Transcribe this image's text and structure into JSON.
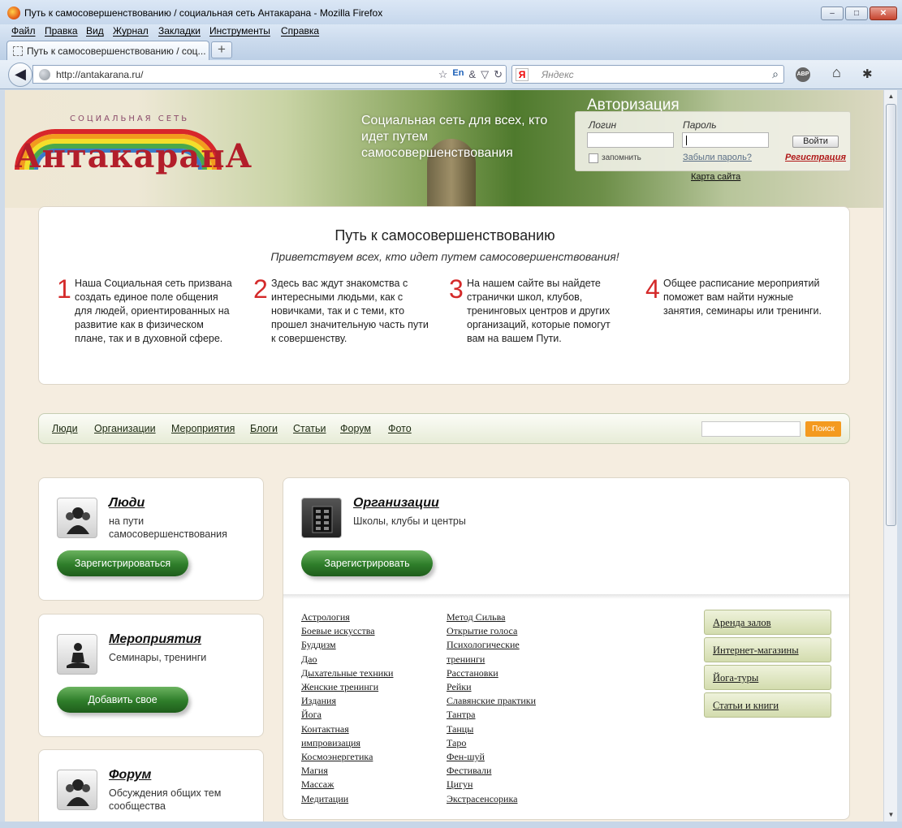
{
  "window": {
    "title": "Путь к самосовершенствованию / социальная сеть Антакарана - Mozilla Firefox",
    "controls": [
      "–",
      "□",
      "✕"
    ]
  },
  "menu": [
    "Файл",
    "Правка",
    "Вид",
    "Журнал",
    "Закладки",
    "Инструменты",
    "Справка"
  ],
  "tab": {
    "title": "Путь к самосовершенствованию / соц...",
    "new_tab": "+"
  },
  "nav": {
    "back": "◀",
    "url": "http://antakarana.ru/",
    "url_icons": [
      "☆",
      "En",
      "&",
      "▽",
      "↻"
    ],
    "search_engine": "Я",
    "search_placeholder": "Яндекс",
    "search_icon": "⌕",
    "abp": "ABP",
    "home_icon": "⌂",
    "addon_icon": "✱"
  },
  "header": {
    "logo_sub": "СОЦИАЛЬНАЯ СЕТЬ",
    "logo_name": "АнтакаранА",
    "tagline": "Социальная сеть для всех, кто идет путем самосовершенствования"
  },
  "auth": {
    "title": "Авторизация",
    "login_label": "Логин",
    "password_label": "Пароль",
    "submit": "Войти",
    "remember": "запомнить",
    "forgot": "Забыли пароль?",
    "register": "Регистрация",
    "sitemap": "Карта сайта"
  },
  "welcome": {
    "title": "Путь к самосовершенствованию",
    "subtitle": "Приветствуем всех, кто идет путем самосовершенствования!",
    "points": [
      {
        "num": "1",
        "text": "Наша Социальная сеть призвана создать единое поле общения для людей, ориентированных на развитие как в физическом плане, так и в духовной сфере."
      },
      {
        "num": "2",
        "text": "Здесь вас ждут знакомства с интересными людьми, как с новичками, так и с теми, кто прошел значительную часть пути к совершенству."
      },
      {
        "num": "3",
        "text": "На нашем сайте вы найдете странички школ, клубов, тренинговых центров и других организаций, которые помогут вам на вашем Пути."
      },
      {
        "num": "4",
        "text": "Общее расписание мероприятий поможет вам найти нужные занятия, семинары или тренинги."
      }
    ]
  },
  "sitenav": {
    "links": [
      "Люди",
      "Организации",
      "Мероприятия",
      "Блоги",
      "Статьи",
      "Форум",
      "Фото"
    ],
    "search_button": "Поиск"
  },
  "cards": {
    "people": {
      "title": "Люди",
      "desc": "на пути самосовершенствования",
      "button": "Зарегистрироваться"
    },
    "events": {
      "title": "Мероприятия",
      "desc": "Семинары, тренинги",
      "button": "Добавить свое"
    },
    "forum": {
      "title": "Форум",
      "desc": "Обсуждения общих тем сообщества"
    },
    "orgs": {
      "title": "Организации",
      "desc": "Школы, клубы и центры",
      "button": "Зарегистрировать"
    }
  },
  "categories": {
    "col1": [
      "Астрология",
      "Боевые искусства",
      "Буддизм",
      "Дао",
      "Дыхательные техники",
      "Женские тренинги",
      "Издания",
      "Йога",
      "Контактная импровизация",
      "Космоэнергетика",
      "Магия",
      "Массаж",
      "Медитации"
    ],
    "col2": [
      "Метод Сильва",
      "Открытие голоса",
      "Психологические тренинги",
      "Расстановки",
      "Рейки",
      "Славянские практики",
      "Тантра",
      "Танцы",
      "Таро",
      "Фен-шуй",
      "Фестивали",
      "Цигун",
      "Экстрасенсорика"
    ],
    "side": [
      "Аренда залов",
      "Интернет-магазины",
      "Йога-туры",
      "Статьи и книги"
    ]
  },
  "colors": {
    "accent_green": "#2e7d2a",
    "accent_red": "#d42a2a",
    "search_orange": "#f49a1f"
  }
}
